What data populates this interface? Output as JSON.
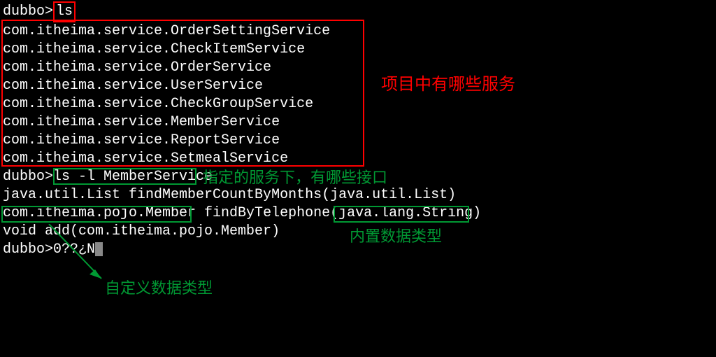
{
  "prompt1": "dubbo>",
  "cmd1": "ls",
  "services": [
    "com.itheima.service.OrderSettingService",
    "com.itheima.service.CheckItemService",
    "com.itheima.service.OrderService",
    "com.itheima.service.UserService",
    "com.itheima.service.CheckGroupService",
    "com.itheima.service.MemberService",
    "com.itheima.service.ReportService",
    "com.itheima.service.SetmealService"
  ],
  "prompt2": "dubbo>",
  "cmd2": "ls -l MemberService",
  "method1": "java.util.List findMemberCountByMonths(java.util.List)",
  "method2_return": "com.itheima.pojo.Member",
  "method2_name": " findByTelephone(",
  "method2_param": "java.lang.String",
  "method2_end": ")",
  "method3": "void add(com.itheima.pojo.Member)",
  "prompt3": "dubbo>",
  "cursor_text": "0??¿N",
  "annotations": {
    "red1": "项目中有哪些服务",
    "green1": "指定的服务下，有哪些接口",
    "green2": "内置数据类型",
    "green3": "自定义数据类型"
  }
}
